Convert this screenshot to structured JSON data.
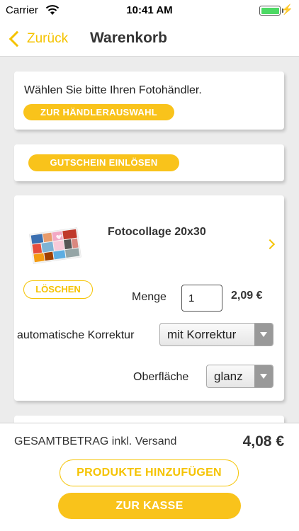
{
  "status_bar": {
    "carrier": "Carrier",
    "time": "10:41 AM",
    "wifi_icon": "wifi-icon",
    "battery_icon": "battery-icon",
    "charging_icon": "charging-bolt-icon",
    "bolt_glyph": "⚡"
  },
  "nav": {
    "back_label": "Zurück",
    "title": "Warenkorb"
  },
  "dealer_card": {
    "text": "Wählen Sie bitte Ihren Fotohändler.",
    "button_label": "ZUR HÄNDLERAUSWAHL"
  },
  "voucher_card": {
    "button_label": "GUTSCHEIN EINLÖSEN"
  },
  "product": {
    "title": "Fotocollage 20x30",
    "delete_label": "LÖSCHEN",
    "quantity_label": "Menge",
    "quantity_value": "1",
    "price": "2,09 €",
    "correction_label": "automatische Korrektur",
    "correction_value": "mit Korrektur",
    "surface_label": "Oberfläche",
    "surface_value": "glanz"
  },
  "footer": {
    "total_label": "GESAMTBETRAG inkl. Versand",
    "total_value": "4,08 €",
    "add_products_label": "PRODUKTE HINZUFÜGEN",
    "checkout_label": "ZUR KASSE"
  },
  "colors": {
    "accent": "#f9c31b",
    "accent_outline": "#f5c300",
    "background": "#ececec",
    "battery": "#4cd964"
  }
}
